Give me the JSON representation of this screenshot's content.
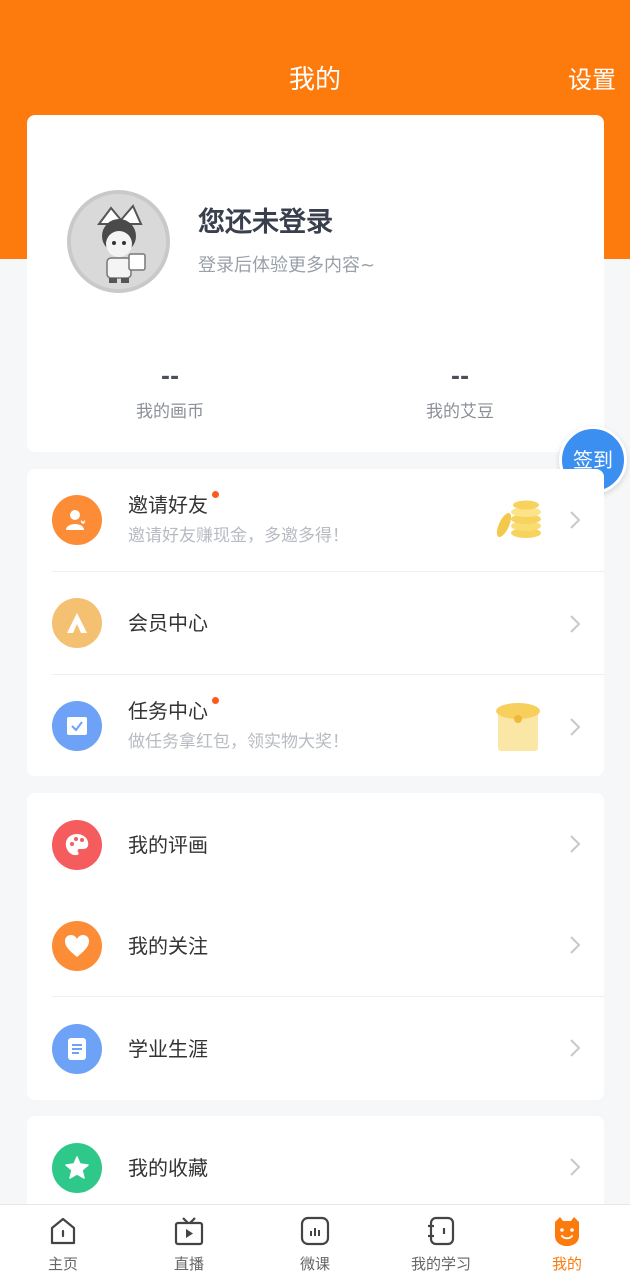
{
  "header": {
    "title": "我的",
    "settings_label": "设置",
    "bg_color": "#fd7a0c"
  },
  "profile": {
    "title": "您还未登录",
    "subtitle": "登录后体验更多内容~",
    "stats": [
      {
        "value": "--",
        "label": "我的画币"
      },
      {
        "value": "--",
        "label": "我的艾豆"
      }
    ]
  },
  "signin_label": "签到",
  "group1": [
    {
      "title": "邀请好友",
      "subtitle": "邀请好友赚现金，多邀多得！",
      "icon": "user-heart-icon",
      "color": "#fd8c37",
      "dot": true,
      "deco": "gold-coins-icon"
    },
    {
      "title": "会员中心",
      "subtitle": "",
      "icon": "vip-a-icon",
      "color": "#f3c171",
      "dot": false,
      "deco": ""
    },
    {
      "title": "任务中心",
      "subtitle": "做任务拿红包，领实物大奖！",
      "icon": "task-check-icon",
      "color": "#6ea2f6",
      "dot": true,
      "deco": "gift-box-icon"
    }
  ],
  "group2": [
    {
      "title": "我的评画",
      "icon": "palette-icon",
      "color": "#f45c5e"
    },
    {
      "title": "我的关注",
      "icon": "heart-icon",
      "color": "#fd8c37"
    },
    {
      "title": "学业生涯",
      "icon": "document-icon",
      "color": "#6ea2f6"
    }
  ],
  "group3": [
    {
      "title": "我的收藏",
      "icon": "star-icon",
      "color": "#2ec98a"
    }
  ],
  "tabs": [
    {
      "label": "主页",
      "icon": "home-icon",
      "active": false
    },
    {
      "label": "直播",
      "icon": "tv-icon",
      "active": false
    },
    {
      "label": "微课",
      "icon": "microcourse-icon",
      "active": false
    },
    {
      "label": "我的学习",
      "icon": "notebook-icon",
      "active": false
    },
    {
      "label": "我的",
      "icon": "profile-face-icon",
      "active": true
    }
  ]
}
